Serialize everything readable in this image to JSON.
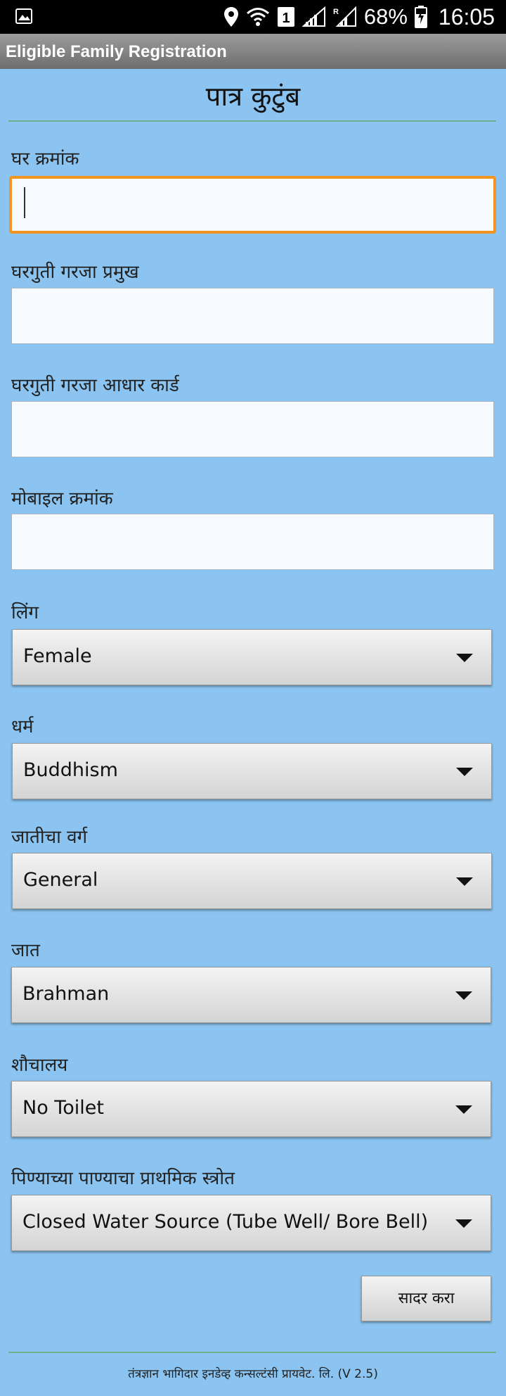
{
  "status_bar": {
    "battery_percent": "68%",
    "time": "16:05",
    "sim_badge": "1",
    "roaming_badge": "R"
  },
  "action_bar": {
    "title": "Eligible Family Registration"
  },
  "form": {
    "heading": "पात्र कुटुंब",
    "house_number": {
      "label": "घर क्रमांक",
      "value": ""
    },
    "household_head": {
      "label": "घरगुती गरजा प्रमुख",
      "value": ""
    },
    "household_aadhaar": {
      "label": "घरगुती गरजा आधार कार्ड",
      "value": ""
    },
    "mobile_number": {
      "label": "मोबाइल क्रमांक",
      "value": ""
    },
    "gender": {
      "label": "लिंग",
      "selected": "Female"
    },
    "religion": {
      "label": "धर्म",
      "selected": "Buddhism"
    },
    "caste_category": {
      "label": "जातीचा वर्ग",
      "selected": "General"
    },
    "caste": {
      "label": "जात",
      "selected": "Brahman"
    },
    "toilet": {
      "label": "शौचालय",
      "selected": "No Toilet"
    },
    "water_source": {
      "label": "पिण्याच्या पाण्याचा प्राथमिक स्त्रोत",
      "selected": "Closed Water Source (Tube Well/ Bore Bell)"
    },
    "submit_label": "सादर करा"
  },
  "footer": {
    "text": "तंत्रज्ञान भागिदार इनडेव्ह कन्सल्टंसी प्रायवेट. लि. (V 2.5)"
  },
  "colors": {
    "background": "#8bc4f0",
    "focus_border": "#f09522",
    "divider": "#6db08c"
  }
}
